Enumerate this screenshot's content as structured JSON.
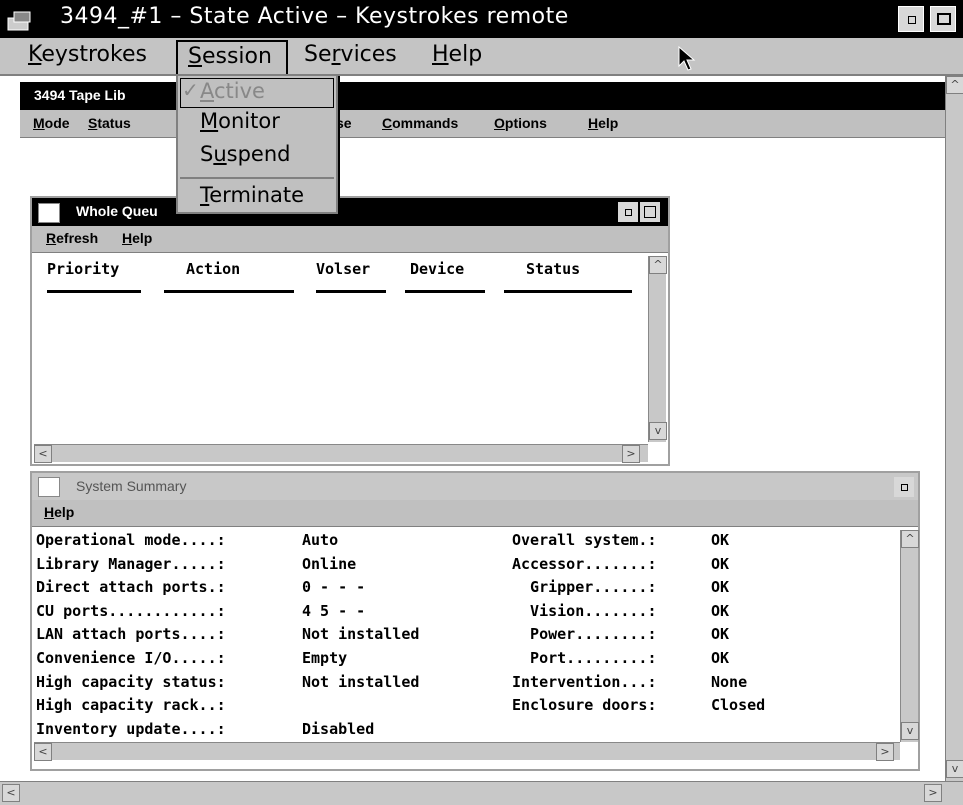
{
  "window": {
    "title": "3494_#1 – State Active – Keystrokes remote",
    "menu": [
      {
        "pre": "",
        "ul": "K",
        "post": "eystrokes"
      },
      {
        "pre": "",
        "ul": "S",
        "post": "ession"
      },
      {
        "pre": "Se",
        "ul": "r",
        "post": "vices"
      },
      {
        "pre": "",
        "ul": "H",
        "post": "elp"
      }
    ]
  },
  "session_menu": {
    "items": [
      {
        "pre": "",
        "ul": "A",
        "post": "ctive",
        "checked": true,
        "disabled": true
      },
      {
        "pre": "",
        "ul": "M",
        "post": "onitor"
      },
      {
        "pre": "S",
        "ul": "u",
        "post": "spend"
      },
      {
        "pre": "",
        "ul": "T",
        "post": "erminate"
      }
    ]
  },
  "library": {
    "title": "3494 Tape Lib",
    "menu": [
      {
        "pre": "",
        "ul": "M",
        "post": "ode"
      },
      {
        "pre": "",
        "ul": "S",
        "post": "tatus"
      },
      {
        "pre": "",
        "ul": "",
        "post": "se"
      },
      {
        "pre": "",
        "ul": "C",
        "post": "ommands"
      },
      {
        "pre": "",
        "ul": "O",
        "post": "ptions"
      },
      {
        "pre": "",
        "ul": "H",
        "post": "elp"
      }
    ]
  },
  "whole_queue": {
    "title": "Whole Queu",
    "menu": [
      {
        "pre": "",
        "ul": "R",
        "post": "efresh"
      },
      {
        "pre": "",
        "ul": "H",
        "post": "elp"
      }
    ],
    "columns": [
      "Priority",
      "Action",
      "Volser",
      "Device",
      "Status"
    ]
  },
  "system_summary": {
    "title": "System Summary",
    "menu": [
      {
        "pre": "",
        "ul": "H",
        "post": "elp"
      }
    ],
    "left_rows": [
      {
        "label": "Operational mode....:",
        "value": "Auto"
      },
      {
        "label": "Library Manager.....:",
        "value": "Online"
      },
      {
        "label": "Direct attach ports.:",
        "value": "0 - - -"
      },
      {
        "label": "CU ports............:",
        "value": "4 5 - -"
      },
      {
        "label": "LAN attach ports....:",
        "value": "Not installed"
      },
      {
        "label": "Convenience I/O.....:",
        "value": "Empty"
      },
      {
        "label": "High capacity status:",
        "value": "Not installed"
      },
      {
        "label": "High capacity rack..:",
        "value": ""
      },
      {
        "label": "Inventory update....:",
        "value": "Disabled"
      }
    ],
    "right_rows": [
      {
        "label": "Overall system.:",
        "value": "OK"
      },
      {
        "label": "Accessor.......:",
        "value": "OK"
      },
      {
        "label": "  Gripper......:",
        "value": "OK"
      },
      {
        "label": "  Vision.......:",
        "value": "OK"
      },
      {
        "label": "  Power........:",
        "value": "OK"
      },
      {
        "label": "  Port.........:",
        "value": "OK"
      },
      {
        "label": "Intervention...:",
        "value": "None"
      },
      {
        "label": "Enclosure doors:",
        "value": "Closed"
      }
    ]
  },
  "icons": {
    "window_icon": "window-icon",
    "cursor": "arrow-cursor-icon",
    "scroll_up": "scroll-up-arrow",
    "scroll_down": "scroll-down-arrow",
    "scroll_left": "scroll-left-arrow",
    "scroll_right": "scroll-right-arrow"
  }
}
